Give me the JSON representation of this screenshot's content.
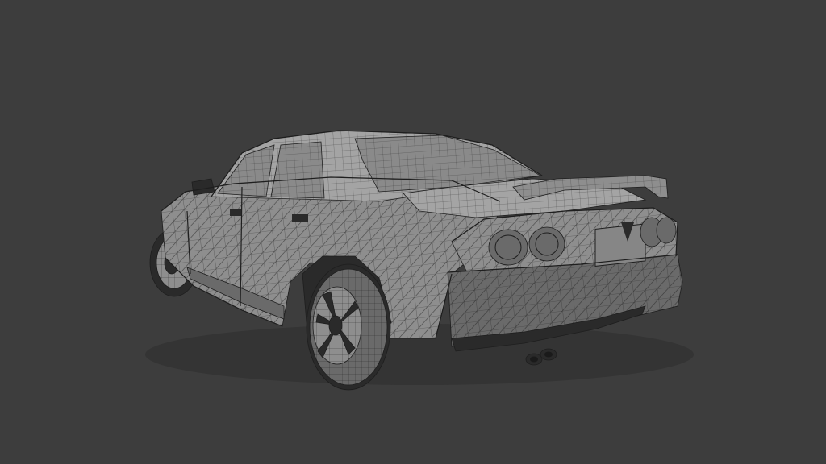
{
  "viewport": {
    "background_color": "#3d3d3d"
  },
  "model": {
    "subject": "car",
    "render_style": "wireframe-on-shaded",
    "body_color": "#8e8e8e",
    "shadow_color": "#6a6a6a",
    "highlight_color": "#a4a4a4",
    "wire_color": "#1e1e1e",
    "dark_color": "#2a2a2a",
    "glass_color": "#8a8a8a"
  }
}
